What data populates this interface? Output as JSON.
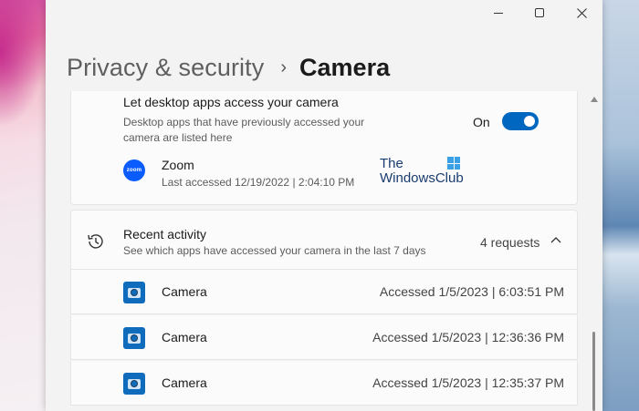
{
  "breadcrumb": {
    "parent": "Privacy & security",
    "separator": "›",
    "current": "Camera"
  },
  "desktop_access": {
    "title": "Let desktop apps access your camera",
    "description_line1": "Desktop apps that have previously accessed your",
    "description_line2": "camera are listed here",
    "toggle_label": "On",
    "toggle_on": true,
    "app": {
      "name": "Zoom",
      "icon_text": "zoom",
      "last_accessed": "Last accessed 12/19/2022  |  2:04:10 PM"
    }
  },
  "watermark": {
    "line1": "The",
    "line2": "WindowsClub"
  },
  "recent_activity": {
    "title": "Recent activity",
    "description": "See which apps have accessed your camera in the last 7 days",
    "requests": "4 requests",
    "items": [
      {
        "name": "Camera",
        "accessed": "Accessed 1/5/2023  |  6:03:51 PM"
      },
      {
        "name": "Camera",
        "accessed": "Accessed 1/5/2023  |  12:36:36 PM"
      },
      {
        "name": "Camera",
        "accessed": "Accessed 1/5/2023  |  12:35:37 PM"
      }
    ]
  },
  "colors": {
    "accent": "#0067c0",
    "zoom_brand": "#0b5cff"
  }
}
